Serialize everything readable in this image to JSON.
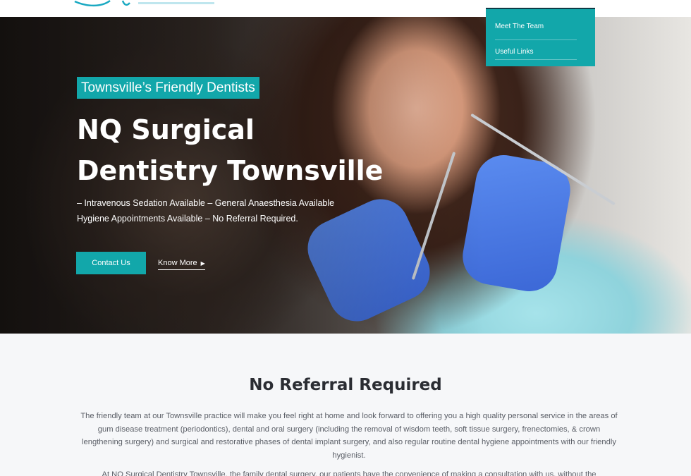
{
  "header": {
    "logo_alt": "NQ Surgical Dentistry logo"
  },
  "nav_dropdown": {
    "items": [
      "Meet The Team",
      "Useful Links"
    ]
  },
  "hero": {
    "tagline": "Townsville’s Friendly Dentists",
    "title_line1": "NQ Surgical",
    "title_line2": "Dentistry Townsville",
    "sub_line1": "– Intravenous Sedation Available – General Anaesthesia Available",
    "sub_line2": "Hygiene Appointments Available – No Referral Required.",
    "contact_label": "Contact Us",
    "know_more_label": "Know More",
    "arrow_icon": "play-arrow-icon"
  },
  "section": {
    "title": "No Referral Required",
    "paragraph1": "The friendly team at our Townsville practice will make you feel right at home and look forward to offering you a high quality personal service in the areas of gum disease treatment (periodontics), dental and oral surgery (including the removal of wisdom teeth, soft tissue surgery, frenectomies, & crown lengthening surgery) and surgical and restorative phases of dental implant surgery, and also regular routine dental hygiene appointments with our friendly hygienist.",
    "paragraph2": "At NQ Surgical Dentistry Townsville, the family dental surgery, our patients have the convenience of making a consultation with us, without the"
  },
  "colors": {
    "accent": "#12a7aa",
    "heading": "#2b2d33",
    "body_text": "#5a5e66",
    "background": "#f6f7f9"
  }
}
